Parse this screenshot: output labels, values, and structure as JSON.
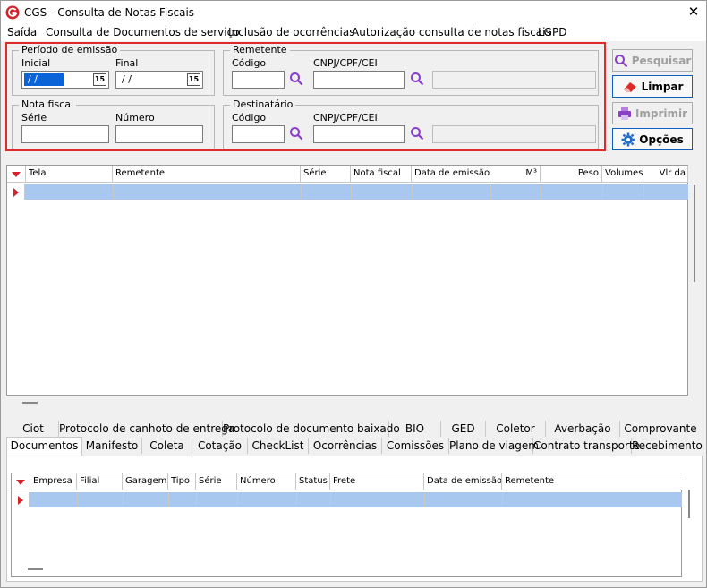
{
  "window": {
    "title": "CGS - Consulta de Notas Fiscais",
    "close_label": "✕"
  },
  "menu": {
    "items": [
      "Saída",
      "Consulta de Documentos de serviço",
      "Inclusão de ocorrências",
      "Autorização consulta de notas fiscais",
      "LGPD"
    ]
  },
  "filters": {
    "periodo": {
      "title": "Período de emissão",
      "inicial_label": "Inicial",
      "final_label": "Final",
      "inicial_value": "/ /",
      "final_value": "/ /",
      "cal_icon": "15"
    },
    "remetente": {
      "title": "Remetente",
      "codigo_label": "Código",
      "cnpj_label": "CNPJ/CPF/CEI"
    },
    "nota": {
      "title": "Nota fiscal",
      "serie_label": "Série",
      "numero_label": "Número"
    },
    "destinatario": {
      "title": "Destinatário",
      "codigo_label": "Código",
      "cnpj_label": "CNPJ/CPF/CEI"
    }
  },
  "buttons": {
    "pesquisar": "Pesquisar",
    "limpar": "Limpar",
    "imprimir": "Imprimir",
    "opcoes": "Opções"
  },
  "grid1": {
    "columns": [
      "Tela",
      "Remetente",
      "Série",
      "Nota fiscal",
      "Data de emissão",
      "M³",
      "Peso",
      "Volumes",
      "Vlr da"
    ]
  },
  "tabs_top": [
    "Ciot",
    "Protocolo de canhoto de entrega",
    "Protocolo de documento baixado",
    "BIO",
    "GED",
    "Coletor",
    "Averbação",
    "Comprovante"
  ],
  "tabs_bottom": [
    "Documentos",
    "Manifesto",
    "Coleta",
    "Cotação",
    "CheckList",
    "Ocorrências",
    "Comissões",
    "Plano de viagem",
    "Contrato transporte",
    "Recebimento"
  ],
  "grid2": {
    "columns": [
      "Empresa",
      "Filial",
      "Garagem",
      "Tipo",
      "Série",
      "Número",
      "Status",
      "Frete",
      "Data de emissão",
      "Remetente"
    ]
  },
  "colors": {
    "accent": "#0f5fbf",
    "highlight": "#e02b2b",
    "selection": "#a8c8ef",
    "icon_purple": "#8a3fc8"
  }
}
